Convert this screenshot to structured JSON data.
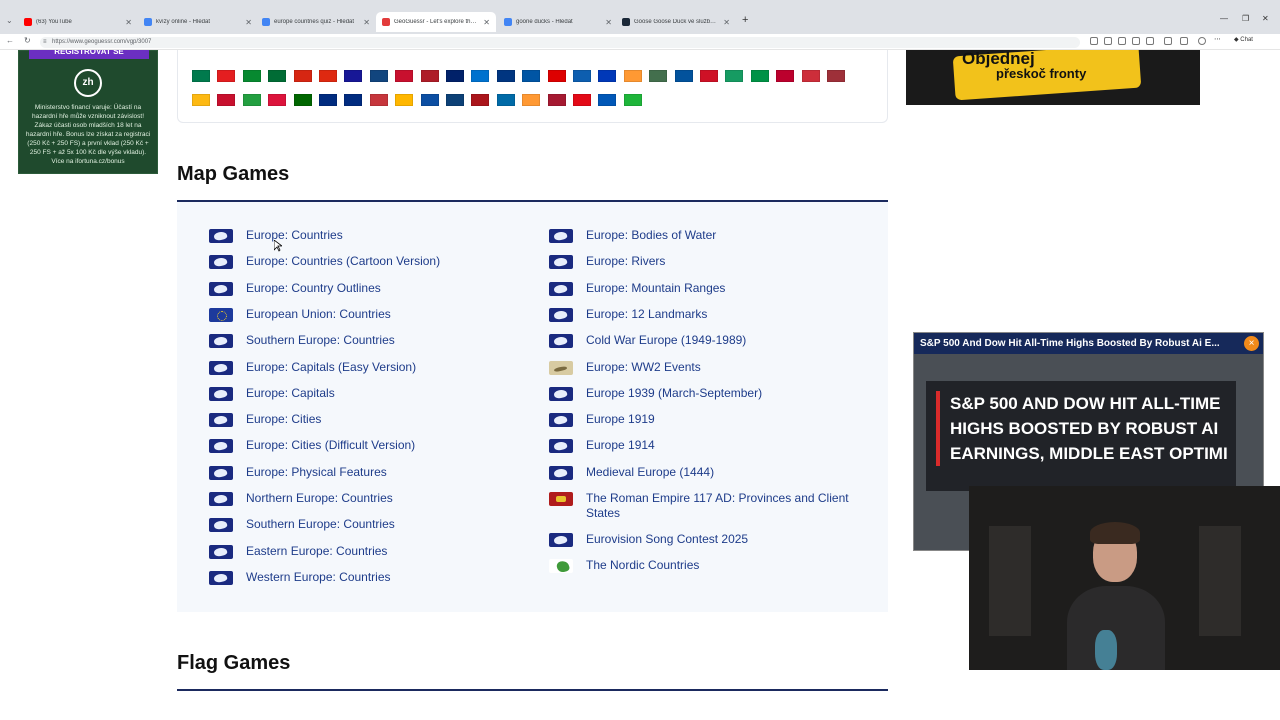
{
  "browser": {
    "tabs": [
      {
        "title": "(63) YouTube",
        "color": "#ff0000"
      },
      {
        "title": "kvízy online - Hledat",
        "color": "#4285f4"
      },
      {
        "title": "europe countries quiz - Hledat",
        "color": "#4285f4"
      },
      {
        "title": "GeoGuessr - Let's explore the wor",
        "color": "#e23b3b"
      },
      {
        "title": "goone ducks - Hledat",
        "color": "#4285f4"
      },
      {
        "title": "Goose Goose Duck ve službě Stea",
        "color": "#1b2838"
      }
    ],
    "active_tab_index": 3,
    "url": "https://www.geoguessr.com/vgp/3007",
    "chat_label": "Chat"
  },
  "left_ad": {
    "badge": "REGISTROVAT SE",
    "logo": "zh",
    "text": "Ministerstvo financí varuje: Účastí na hazardní hře může vzniknout závislost! Zákaz účasti osob mladších 18 let na hazardní hře. Bonus lze získat za registraci (250 Kč + 250 FS) a první vklad (250 Kč + 250 FS + až 5x 100 Kč dle výše vkladu). Více na ifortuna.cz/bonus"
  },
  "right_ad": {
    "line1": "Objednej",
    "line2": "přeskoč fronty"
  },
  "sections": {
    "map_games_title": "Map Games",
    "flag_games_title": "Flag Games"
  },
  "map_games": {
    "left": [
      {
        "label": "Europe: Countries",
        "icon": "europe-map-icon"
      },
      {
        "label": "Europe: Countries (Cartoon Version)",
        "icon": "europe-map-icon"
      },
      {
        "label": "Europe: Country Outlines",
        "icon": "europe-map-icon"
      },
      {
        "label": "European Union: Countries",
        "icon": "eu-flag-icon"
      },
      {
        "label": "Southern Europe: Countries",
        "icon": "europe-map-icon"
      },
      {
        "label": "Europe: Capitals (Easy Version)",
        "icon": "europe-map-icon"
      },
      {
        "label": "Europe: Capitals",
        "icon": "europe-map-icon"
      },
      {
        "label": "Europe: Cities",
        "icon": "europe-map-icon"
      },
      {
        "label": "Europe: Cities (Difficult Version)",
        "icon": "europe-map-icon"
      },
      {
        "label": "Europe: Physical Features",
        "icon": "europe-map-icon"
      },
      {
        "label": "Northern Europe: Countries",
        "icon": "europe-map-icon"
      },
      {
        "label": "Southern Europe: Countries",
        "icon": "europe-map-icon"
      },
      {
        "label": "Eastern Europe: Countries",
        "icon": "europe-map-icon"
      },
      {
        "label": "Western Europe: Countries",
        "icon": "europe-map-icon"
      }
    ],
    "right": [
      {
        "label": "Europe: Bodies of Water",
        "icon": "europe-map-icon"
      },
      {
        "label": "Europe: Rivers",
        "icon": "europe-map-icon"
      },
      {
        "label": "Europe: Mountain Ranges",
        "icon": "europe-map-icon"
      },
      {
        "label": "Europe: 12 Landmarks",
        "icon": "europe-map-icon"
      },
      {
        "label": "Cold War Europe (1949-1989)",
        "icon": "europe-map-icon"
      },
      {
        "label": "Europe: WW2 Events",
        "icon": "ww2-map-icon"
      },
      {
        "label": "Europe 1939 (March-September)",
        "icon": "europe-map-icon"
      },
      {
        "label": "Europe 1919",
        "icon": "europe-map-icon"
      },
      {
        "label": "Europe 1914",
        "icon": "europe-map-icon"
      },
      {
        "label": "Medieval Europe (1444)",
        "icon": "europe-map-icon"
      },
      {
        "label": "The Roman Empire 117 AD: Provinces and Client States",
        "icon": "roman-empire-icon"
      },
      {
        "label": "Eurovision Song Contest 2025",
        "icon": "europe-map-icon"
      },
      {
        "label": "The Nordic Countries",
        "icon": "nordic-map-icon"
      }
    ]
  },
  "flags": {
    "row1": [
      "#007a4d",
      "#e41e20",
      "#078930",
      "#006c35",
      "#d62612",
      "#de2910",
      "#171796",
      "#11457e",
      "#c8102e",
      "#ae1c28",
      "#012169",
      "#0072ce",
      "#003580",
      "#0055a4",
      "#dd0000",
      "#0d5eaf",
      "#0038b8",
      "#ff9933",
      "#436f4d",
      "#02529c",
      "#ce1126",
      "#169b62",
      "#009246",
      "#bc002d",
      "#cd2e3a",
      "#9e3039"
    ],
    "row2": [
      "#fdb913",
      "#c8102e",
      "#239f40",
      "#dc143c",
      "#006600",
      "#002b7f",
      "#002b7f",
      "#c6363c",
      "#ffb700",
      "#0b4ea2",
      "#0c4076",
      "#aa151b",
      "#006aa7",
      "#ff9933",
      "#a51931",
      "#e30a17",
      "#0057b7",
      "#1eb53a"
    ]
  },
  "news": {
    "headline": "S&P 500 And Dow Hit All-Time Highs Boosted By Robust Ai E...",
    "overlay_text": "S&P 500 AND DOW HIT ALL-TIME HIGHS BOOSTED BY ROBUST AI EARNINGS, MIDDLE EAST OPTIMI",
    "close_label": "×"
  }
}
